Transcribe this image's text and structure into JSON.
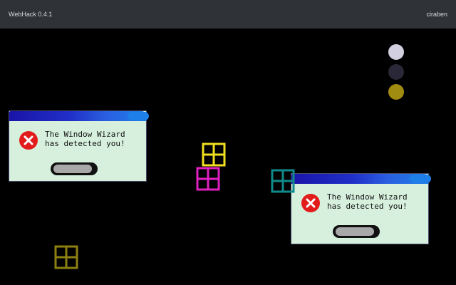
{
  "topbar": {
    "app_title": "WebHack 0.4.1",
    "user_name": "ciraben"
  },
  "color_dots": [
    {
      "name": "light",
      "color": "#d2d0e0"
    },
    {
      "name": "dark",
      "color": "#2a2838"
    },
    {
      "name": "gold",
      "color": "#a08c10"
    }
  ],
  "dialogs": [
    {
      "line1": "The Window Wizard",
      "line2": "has detected you!"
    },
    {
      "line1": "The Window Wizard",
      "line2": "has detected you!"
    }
  ],
  "window_icons": [
    {
      "name": "yellow",
      "color": "#f0e020"
    },
    {
      "name": "magenta",
      "color": "#e020c0"
    },
    {
      "name": "teal",
      "color": "#108a8a"
    },
    {
      "name": "olive",
      "color": "#8c8010"
    }
  ]
}
